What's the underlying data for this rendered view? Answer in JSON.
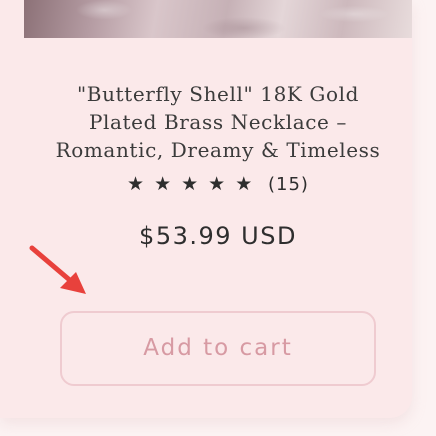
{
  "product": {
    "title": "\"Butterfly Shell\" 18K Gold Plated Brass Necklace – Romantic, Dreamy & Timeless",
    "rating": {
      "stars": 5,
      "star_glyph": "★",
      "count_text": "(15)"
    },
    "price": "$53.99 USD",
    "add_to_cart_label": "Add to cart",
    "image_icon": "product-photo-icon"
  },
  "colors": {
    "card_background": "#fbe9ea",
    "page_background": "#fcf3f3",
    "button_border": "#efcbd0",
    "button_text": "#d79aa3",
    "arrow": "#e8413c",
    "text": "#2e2e2e"
  },
  "annotation": {
    "arrow_icon": "red-arrow-icon"
  }
}
